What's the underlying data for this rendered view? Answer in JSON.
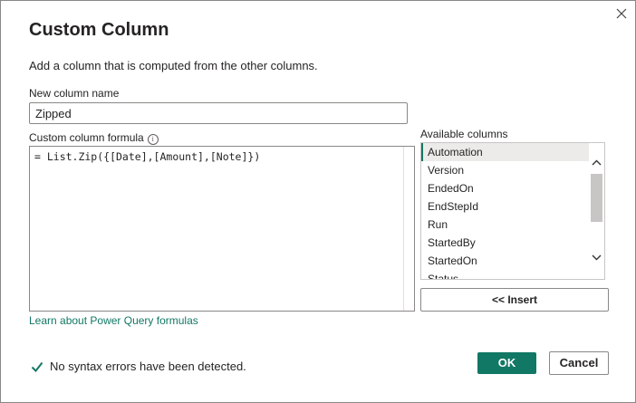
{
  "dialog": {
    "title": "Custom Column",
    "description": "Add a column that is computed from the other columns.",
    "close_icon": "close-icon"
  },
  "new_column": {
    "label": "New column name",
    "value": "Zipped"
  },
  "formula": {
    "label": "Custom column formula",
    "info_icon": "info-icon",
    "value": "= List.Zip({[Date],[Amount],[Note]})"
  },
  "available_columns": {
    "label": "Available columns",
    "items": [
      "Automation",
      "Version",
      "EndedOn",
      "EndStepId",
      "Run",
      "StartedBy",
      "StartedOn",
      "Status"
    ],
    "selected": "Automation"
  },
  "buttons": {
    "insert": "<< Insert",
    "ok": "OK",
    "cancel": "Cancel"
  },
  "learn_link": "Learn about Power Query formulas",
  "status": {
    "icon": "check-icon",
    "text": "No syntax errors have been detected.",
    "color": "#117865"
  },
  "colors": {
    "accent": "#117865"
  }
}
